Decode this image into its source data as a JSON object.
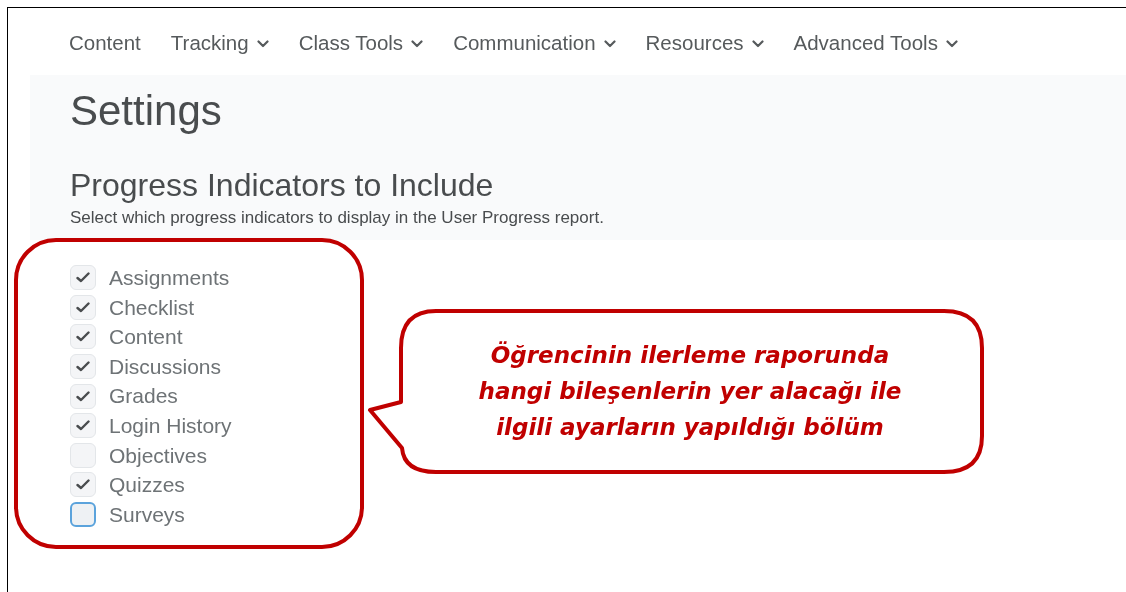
{
  "nav": [
    {
      "label": "Content",
      "dropdown": false
    },
    {
      "label": "Tracking",
      "dropdown": true
    },
    {
      "label": "Class Tools",
      "dropdown": true
    },
    {
      "label": "Communication",
      "dropdown": true
    },
    {
      "label": "Resources",
      "dropdown": true
    },
    {
      "label": "Advanced Tools",
      "dropdown": true
    }
  ],
  "page_title": "Settings",
  "section": {
    "title": "Progress Indicators to Include",
    "description": "Select which progress indicators to display in the User Progress report.",
    "options": [
      {
        "label": "Assignments",
        "checked": true,
        "focused": false
      },
      {
        "label": "Checklist",
        "checked": true,
        "focused": false
      },
      {
        "label": "Content",
        "checked": true,
        "focused": false
      },
      {
        "label": "Discussions",
        "checked": true,
        "focused": false
      },
      {
        "label": "Grades",
        "checked": true,
        "focused": false
      },
      {
        "label": "Login History",
        "checked": true,
        "focused": false
      },
      {
        "label": "Objectives",
        "checked": false,
        "focused": false
      },
      {
        "label": "Quizzes",
        "checked": true,
        "focused": false
      },
      {
        "label": "Surveys",
        "checked": false,
        "focused": true
      }
    ]
  },
  "callout": {
    "text": "Öğrencinin ilerleme raporunda hangi bileşenlerin yer alacağı ile ilgili ayarların yapıldığı bölüm"
  }
}
